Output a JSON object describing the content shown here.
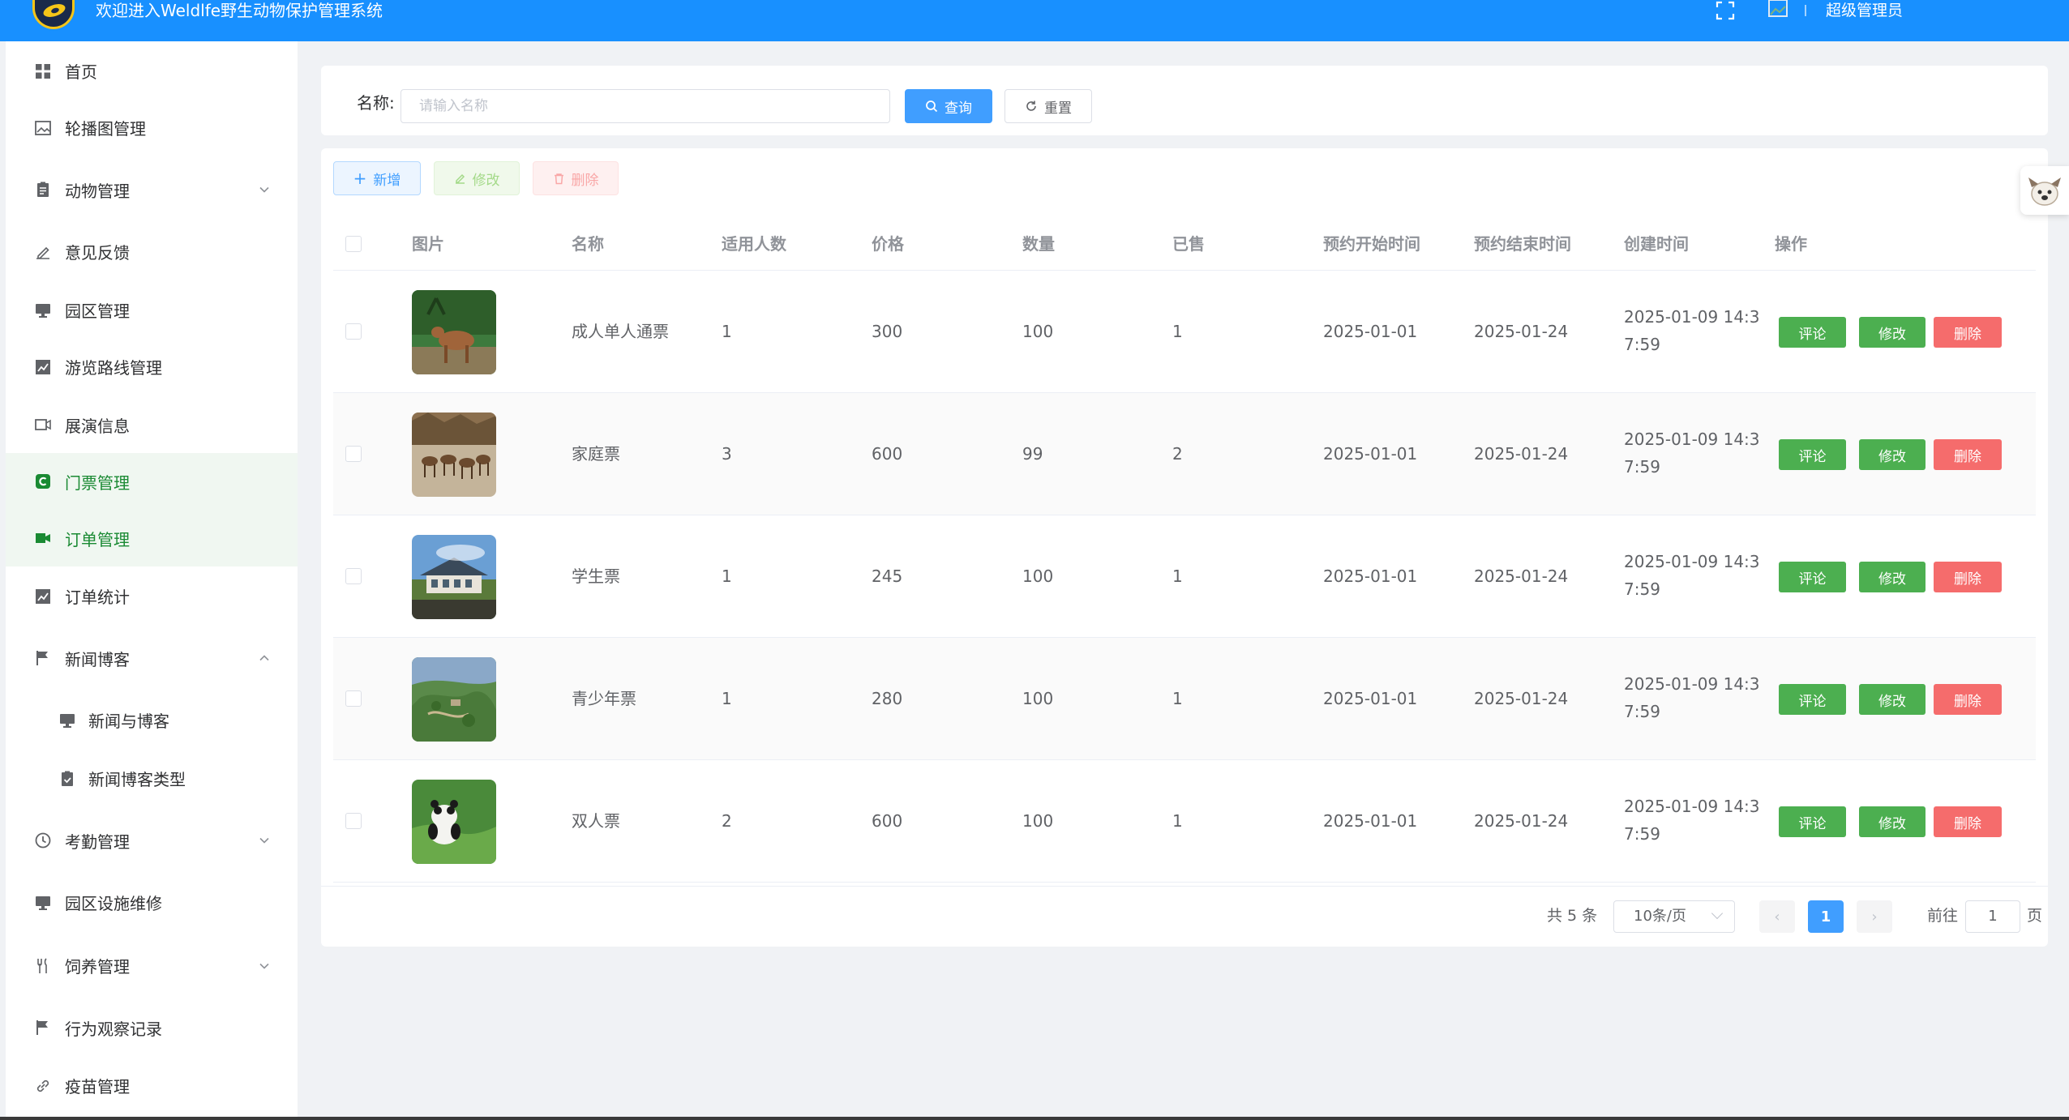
{
  "header": {
    "title": "欢迎进入Weldlfe野生动物保护管理系统",
    "user_name": "超级管理员",
    "accent": "#1890ff"
  },
  "sidebar": {
    "items": [
      {
        "label": "首页",
        "icon": "grid-icon"
      },
      {
        "label": "轮播图管理",
        "icon": "image-icon"
      },
      {
        "label": "动物管理",
        "icon": "clipboard-icon",
        "expandable": true
      },
      {
        "label": "意见反馈",
        "icon": "pen-icon"
      },
      {
        "label": "园区管理",
        "icon": "monitor-icon"
      },
      {
        "label": "游览路线管理",
        "icon": "chart-icon"
      },
      {
        "label": "展演信息",
        "icon": "video-icon"
      },
      {
        "label": "门票管理",
        "icon": "ticket-icon",
        "active": true
      },
      {
        "label": "订单管理",
        "icon": "camera-icon"
      },
      {
        "label": "订单统计",
        "icon": "chart-icon"
      },
      {
        "label": "新闻博客",
        "icon": "flag-icon",
        "expanded": true
      },
      {
        "label": "新闻与博客",
        "icon": "monitor-icon",
        "sub": true
      },
      {
        "label": "新闻博客类型",
        "icon": "check-clipboard-icon",
        "sub": true
      },
      {
        "label": "考勤管理",
        "icon": "clock-icon",
        "expandable": true
      },
      {
        "label": "园区设施维修",
        "icon": "monitor-icon"
      },
      {
        "label": "饲养管理",
        "icon": "fork-icon",
        "expandable": true
      },
      {
        "label": "行为观察记录",
        "icon": "flag-icon"
      },
      {
        "label": "疫苗管理",
        "icon": "link-icon"
      }
    ]
  },
  "search": {
    "label": "名称:",
    "placeholder": "请输入名称",
    "query_label": "查询",
    "reset_label": "重置"
  },
  "toolbar": {
    "add_label": "新增",
    "edit_label": "修改",
    "delete_label": "删除"
  },
  "table": {
    "columns": [
      "图片",
      "名称",
      "适用人数",
      "价格",
      "数量",
      "已售",
      "预约开始时间",
      "预约结束时间",
      "创建时间",
      "操作"
    ],
    "rows": [
      {
        "name": "成人单人通票",
        "people": "1",
        "price": "300",
        "qty": "100",
        "sold": "1",
        "start": "2025-01-01",
        "end": "2025-01-24",
        "created": "2025-01-09 14:37:59",
        "image": "deer"
      },
      {
        "name": "家庭票",
        "people": "3",
        "price": "600",
        "qty": "99",
        "sold": "2",
        "start": "2025-01-01",
        "end": "2025-01-24",
        "created": "2025-01-09 14:37:59",
        "image": "herd"
      },
      {
        "name": "学生票",
        "people": "1",
        "price": "245",
        "qty": "100",
        "sold": "1",
        "start": "2025-01-01",
        "end": "2025-01-24",
        "created": "2025-01-09 14:37:59",
        "image": "building"
      },
      {
        "name": "青少年票",
        "people": "1",
        "price": "280",
        "qty": "100",
        "sold": "1",
        "start": "2025-01-01",
        "end": "2025-01-24",
        "created": "2025-01-09 14:37:59",
        "image": "aerial"
      },
      {
        "name": "双人票",
        "people": "2",
        "price": "600",
        "qty": "100",
        "sold": "1",
        "start": "2025-01-01",
        "end": "2025-01-24",
        "created": "2025-01-09 14:37:59",
        "image": "panda"
      }
    ],
    "action_comment": "评论",
    "action_edit": "修改",
    "action_delete": "删除"
  },
  "pagination": {
    "total_label": "共 5 条",
    "page_size": "10条/页",
    "current_page": "1",
    "goto_label": "前往",
    "goto_value": "1",
    "page_suffix": "页"
  }
}
